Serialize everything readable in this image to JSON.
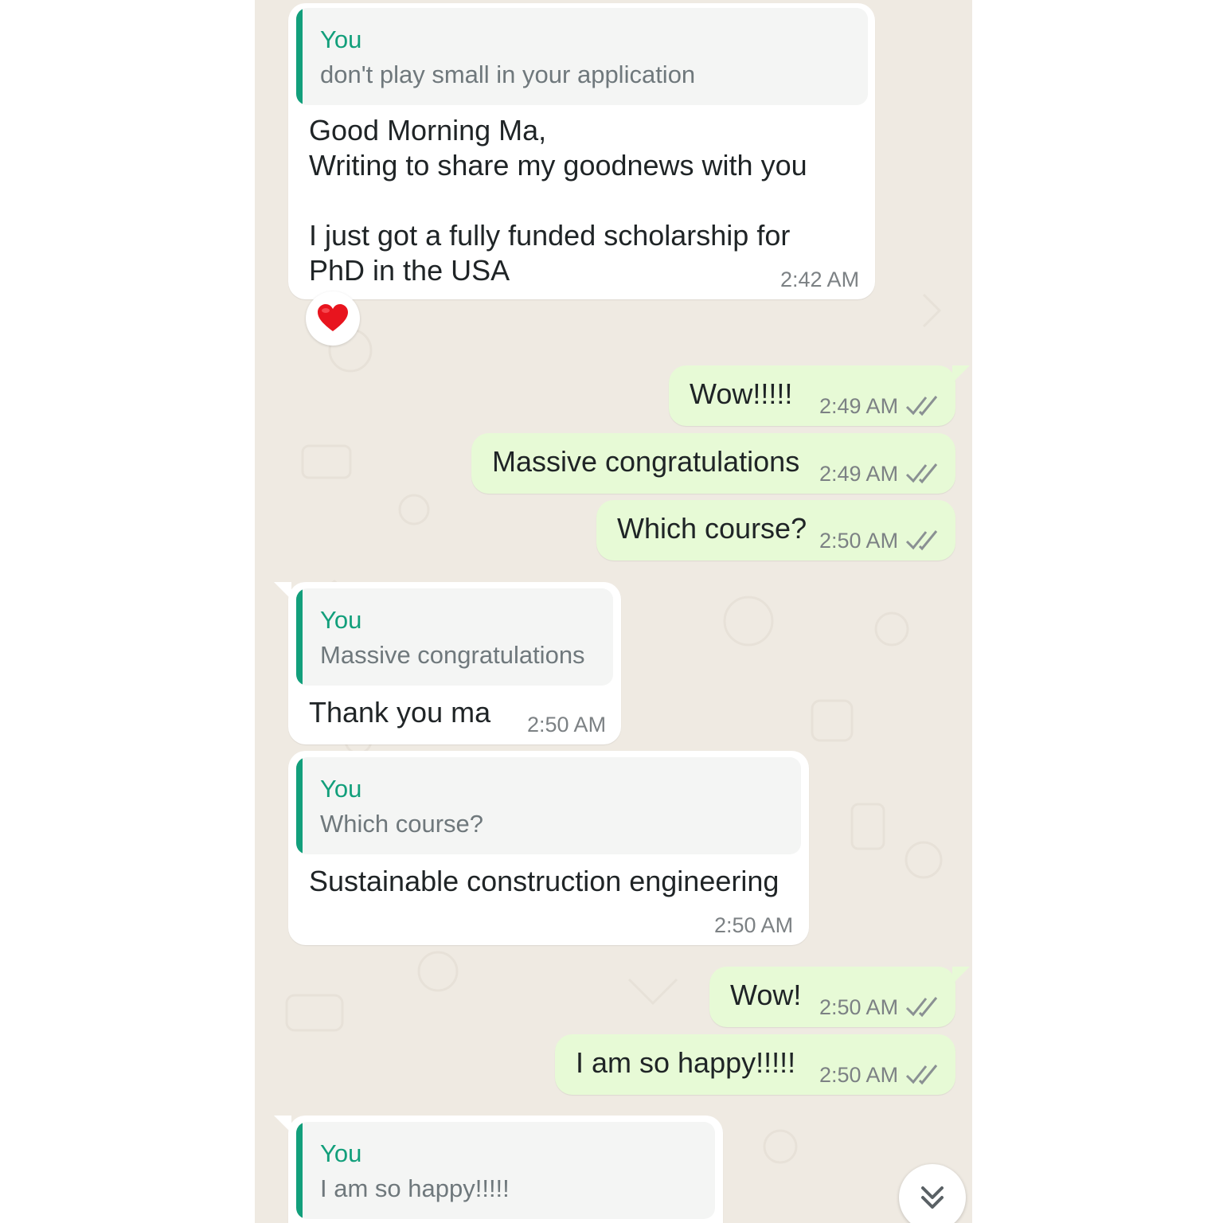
{
  "messages": [
    {
      "direction": "incoming",
      "quote": {
        "author": "You",
        "text": "don't play small in your application"
      },
      "text": "Good Morning Ma,\nWriting to share my goodnews with you\n\nI just got a fully funded scholarship for\nPhD in the USA",
      "time": "2:42 AM",
      "reaction": "red-heart"
    },
    {
      "direction": "outgoing",
      "text": "Wow!!!!!",
      "time": "2:49 AM",
      "status": "read"
    },
    {
      "direction": "outgoing",
      "text": "Massive congratulations",
      "time": "2:49 AM",
      "status": "read"
    },
    {
      "direction": "outgoing",
      "text": "Which course?",
      "time": "2:50 AM",
      "status": "read"
    },
    {
      "direction": "incoming",
      "quote": {
        "author": "You",
        "text": "Massive congratulations"
      },
      "text": "Thank you ma",
      "time": "2:50 AM"
    },
    {
      "direction": "incoming",
      "quote": {
        "author": "You",
        "text": "Which course?"
      },
      "text": "Sustainable construction engineering",
      "time": "2:50 AM"
    },
    {
      "direction": "outgoing",
      "text": "Wow!",
      "time": "2:50 AM",
      "status": "read"
    },
    {
      "direction": "outgoing",
      "text": "I am so happy!!!!!",
      "time": "2:50 AM",
      "status": "read"
    },
    {
      "direction": "incoming",
      "quote": {
        "author": "You",
        "text": "I am so happy!!!!!"
      }
    }
  ],
  "colors": {
    "chat_background": "#efeae2",
    "incoming_bubble": "#ffffff",
    "outgoing_bubble": "#e7fad6",
    "quote_accent": "#129f7b",
    "read_ticks": "#8a9093"
  },
  "icons": {
    "read_status": "double-check-icon",
    "reaction": "red-heart-icon",
    "scroll_down": "double-chevron-down-icon"
  }
}
